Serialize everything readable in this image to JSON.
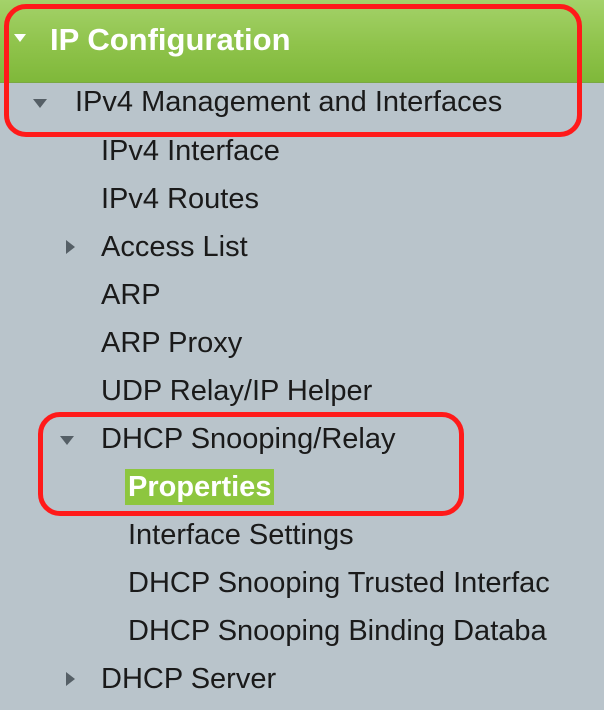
{
  "nav": {
    "header": {
      "label": "IP Configuration",
      "icon": "caret-down-icon"
    },
    "group": {
      "label": "IPv4 Management and Interfaces",
      "icon": "caret-down-icon"
    },
    "items": [
      {
        "label": "IPv4 Interface"
      },
      {
        "label": "IPv4 Routes"
      },
      {
        "label": "Access List",
        "icon": "caret-right-icon"
      },
      {
        "label": "ARP"
      },
      {
        "label": "ARP Proxy"
      },
      {
        "label": "UDP Relay/IP Helper"
      },
      {
        "label": "DHCP Snooping/Relay",
        "icon": "caret-down-icon"
      },
      {
        "label": "DHCP Server",
        "icon": "caret-right-icon"
      }
    ],
    "subitems": [
      {
        "label": "Properties",
        "selected": true
      },
      {
        "label": "Interface Settings"
      },
      {
        "label": "DHCP Snooping Trusted Interfac"
      },
      {
        "label": "DHCP Snooping Binding Databa"
      }
    ]
  },
  "colors": {
    "header_green": "#8fc34b",
    "panel_gray": "#b9c4cb",
    "selected_green": "#8dc63f",
    "annotation_red": "#ff1a1a"
  }
}
